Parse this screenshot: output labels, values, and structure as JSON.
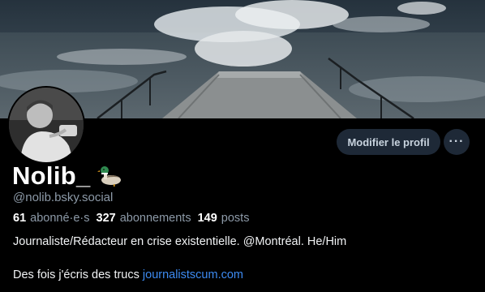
{
  "banner": {
    "description_icon": "ocean-waves-pier-photo"
  },
  "avatar": {
    "icon": "profile-photo"
  },
  "actions": {
    "edit_profile_label": "Modifier le profil",
    "more_label": "···"
  },
  "profile": {
    "display_name": "Nolib_",
    "name_emoji_icon": "duck-icon",
    "handle": "@nolib.bsky.social"
  },
  "stats": {
    "followers_count": "61",
    "followers_label": "abonné·e·s",
    "following_count": "327",
    "following_label": "abonnements",
    "posts_count": "149",
    "posts_label": "posts"
  },
  "bio": {
    "line1": "Journaliste/Rédacteur en crise existentielle. @Montréal. He/Him",
    "line2_text": "Des fois j'écris des trucs ",
    "line2_link": "journalistscum.com"
  },
  "colors": {
    "background": "#000000",
    "button_bg": "#1e2937",
    "muted_text": "#8d9aa8",
    "link": "#3d8bf2"
  }
}
